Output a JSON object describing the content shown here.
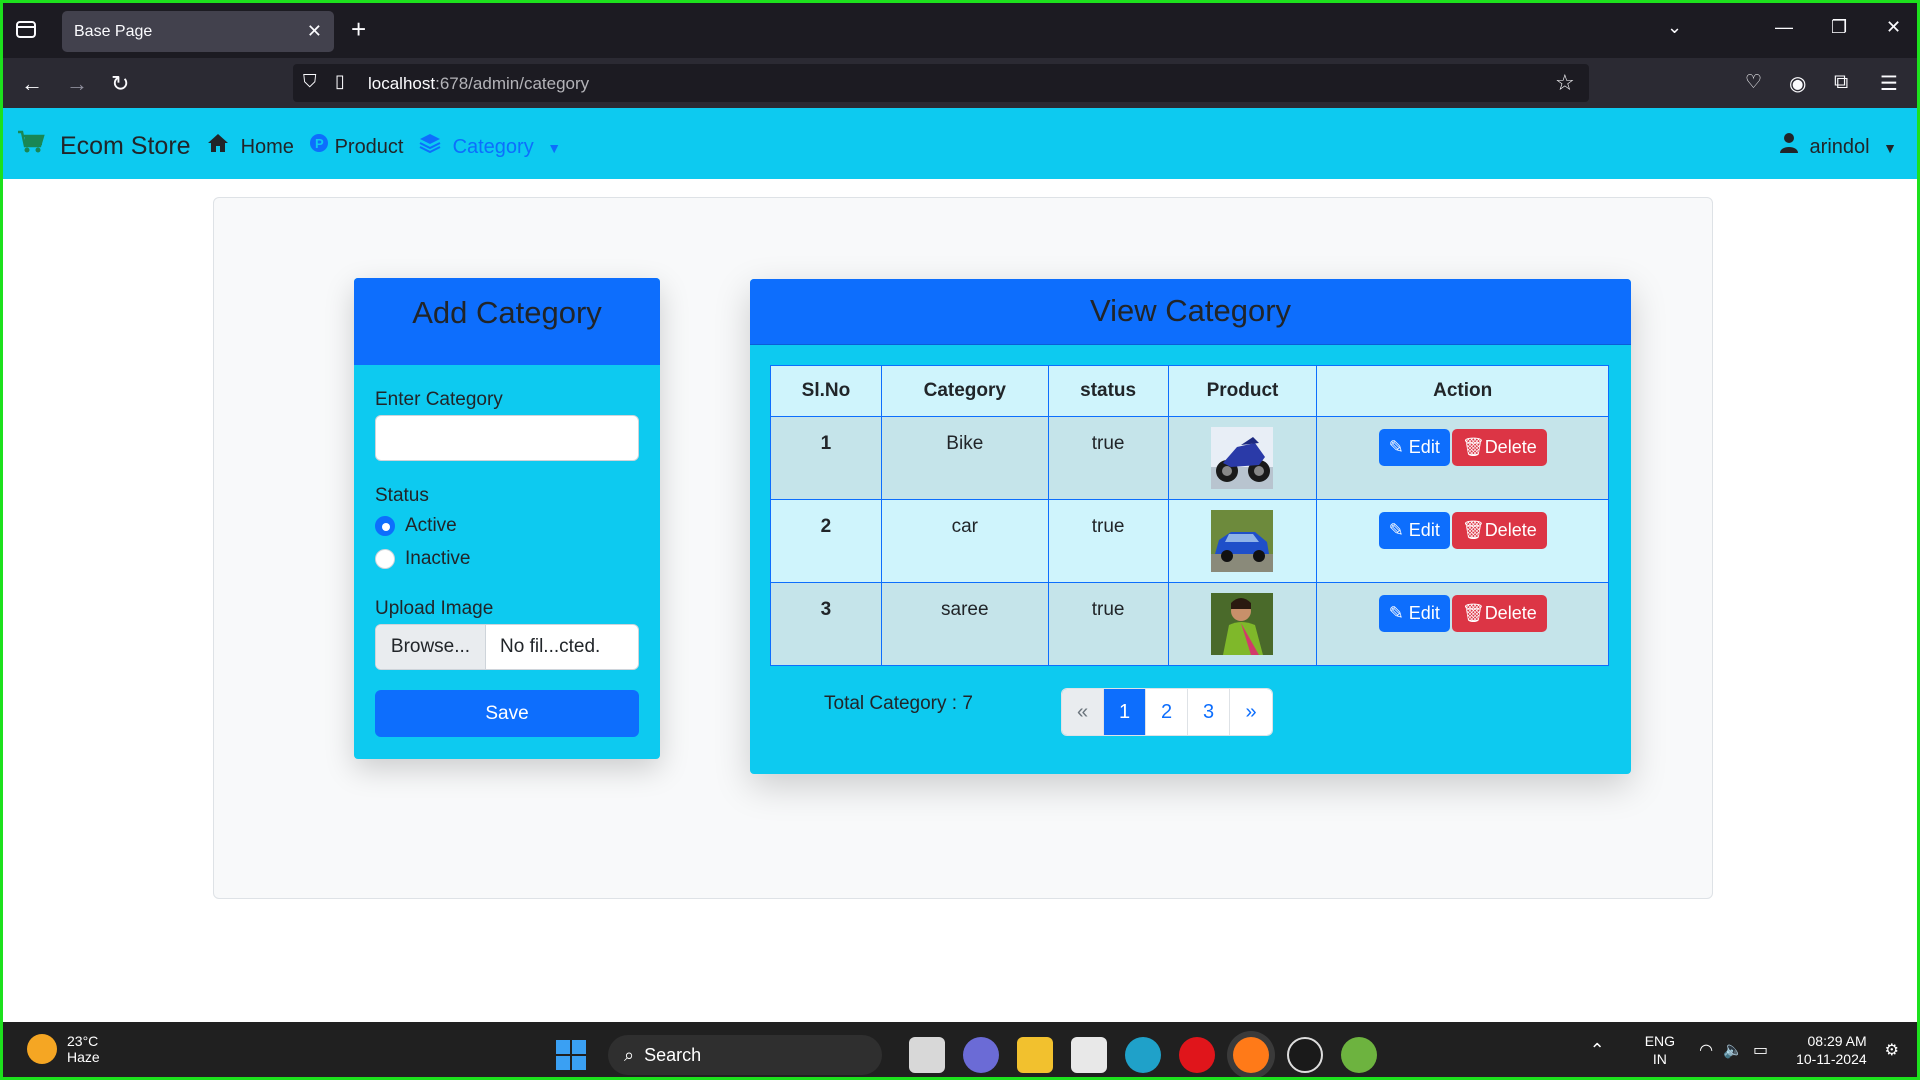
{
  "browser": {
    "tab_title": "Base Page",
    "url_host": "localhost",
    "url_path": ":678/admin/category"
  },
  "app_nav": {
    "brand": "Ecom Store",
    "home": "Home",
    "product": "Product",
    "category": "Category",
    "user": "arindol"
  },
  "add_category": {
    "title": "Add Category",
    "enter_label": "Enter Category",
    "input_value": "",
    "status_label": "Status",
    "status_options": [
      "Active",
      "Inactive"
    ],
    "status_selected": "Active",
    "upload_label": "Upload Image",
    "browse_label": "Browse...",
    "file_name": "No fil...cted.",
    "save_label": "Save"
  },
  "view_category": {
    "title": "View Category",
    "headers": [
      "Sl.No",
      "Category",
      "status",
      "Product",
      "Action"
    ],
    "rows": [
      {
        "sl": "1",
        "category": "Bike",
        "status": "true",
        "image": "bike-thumbnail"
      },
      {
        "sl": "2",
        "category": "car",
        "status": "true",
        "image": "car-thumbnail"
      },
      {
        "sl": "3",
        "category": "saree",
        "status": "true",
        "image": "saree-thumbnail"
      }
    ],
    "edit_label": "Edit",
    "delete_label": "Delete",
    "total_text": "Total Category : 7",
    "pagination": [
      "«",
      "1",
      "2",
      "3",
      "»"
    ],
    "active_page": "1"
  },
  "taskbar": {
    "temp": "23°C",
    "weather": "Haze",
    "search": "Search",
    "lang1": "ENG",
    "lang2": "IN",
    "time": "08:29 AM",
    "date": "10-11-2024"
  },
  "colors": {
    "primary": "#0d6efd",
    "info": "#0dcaf0",
    "danger": "#dc3545",
    "frame": "#1de11d"
  }
}
